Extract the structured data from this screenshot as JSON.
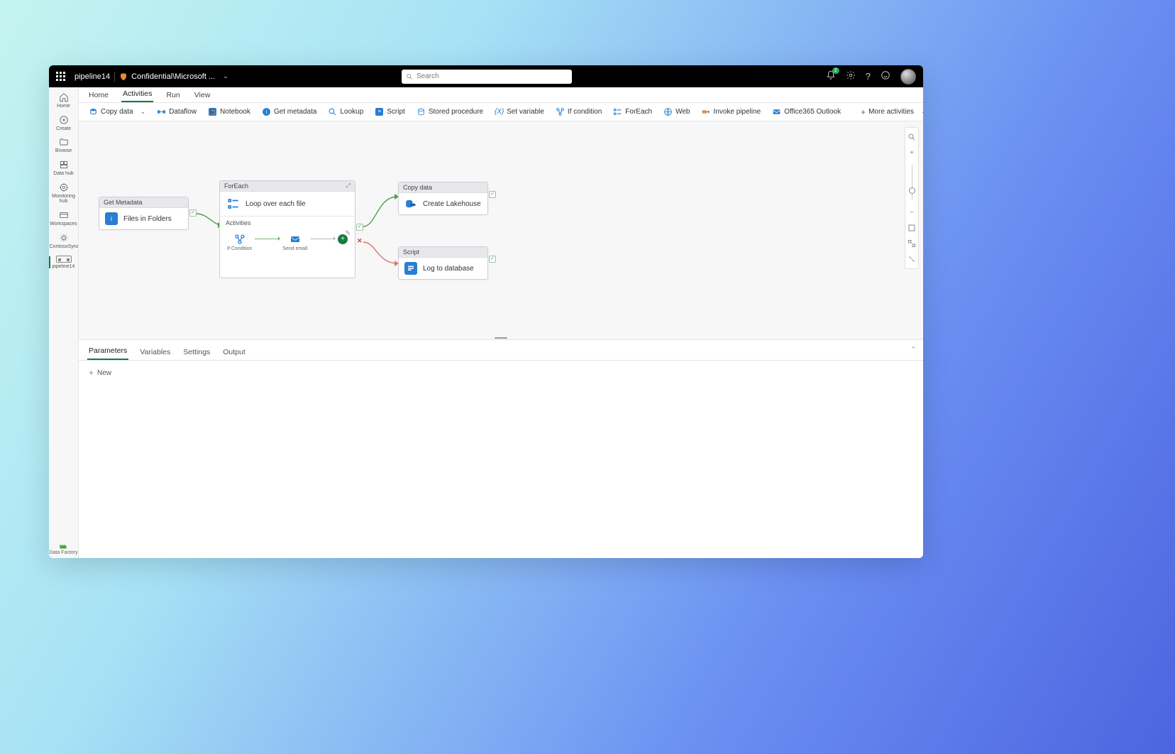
{
  "header": {
    "title": "pipeline14",
    "classification": "Confidential\\Microsoft ...",
    "search_placeholder": "Search",
    "notification_count": "2"
  },
  "left_nav": {
    "items": [
      {
        "label": "Home",
        "icon": "home"
      },
      {
        "label": "Create",
        "icon": "plus-circle"
      },
      {
        "label": "Browse",
        "icon": "folder"
      },
      {
        "label": "Data hub",
        "icon": "data-hub"
      },
      {
        "label": "Monitoring hub",
        "icon": "monitor"
      },
      {
        "label": "Workspaces",
        "icon": "workspaces"
      },
      {
        "label": "ContosoSynapseWorks...",
        "icon": "gear-sparkle"
      },
      {
        "label": "pipeline14",
        "icon": "pipeline",
        "active": true
      }
    ],
    "brand": "Data Factory"
  },
  "tabs": [
    "Home",
    "Activities",
    "Run",
    "View"
  ],
  "active_tab": "Activities",
  "toolbar": [
    {
      "label": "Copy data",
      "icon": "copydata",
      "dropdown": true
    },
    {
      "label": "Dataflow",
      "icon": "dataflow"
    },
    {
      "label": "Notebook",
      "icon": "notebook"
    },
    {
      "label": "Get metadata",
      "icon": "info"
    },
    {
      "label": "Lookup",
      "icon": "lookup"
    },
    {
      "label": "Script",
      "icon": "script"
    },
    {
      "label": "Stored procedure",
      "icon": "sproc"
    },
    {
      "label": "Set variable",
      "icon": "setvar"
    },
    {
      "label": "If condition",
      "icon": "ifcond"
    },
    {
      "label": "ForEach",
      "icon": "foreach"
    },
    {
      "label": "Web",
      "icon": "web"
    },
    {
      "label": "Invoke pipeline",
      "icon": "invoke"
    },
    {
      "label": "Office365 Outlook",
      "icon": "outlook"
    }
  ],
  "more_activities": "More activities",
  "canvas": {
    "get_metadata": {
      "header": "Get Metadata",
      "label": "Files in Folders"
    },
    "foreach": {
      "header": "ForEach",
      "label": "Loop over each file",
      "activities_header": "Activities",
      "mini1": "If Condition",
      "mini2": "Send email"
    },
    "copy": {
      "header": "Copy data",
      "label": "Create Lakehouse"
    },
    "script": {
      "header": "Script",
      "label": "Log to database"
    }
  },
  "bottom_panel": {
    "tabs": [
      "Parameters",
      "Variables",
      "Settings",
      "Output"
    ],
    "active_tab": "Parameters",
    "new_label": "New"
  }
}
